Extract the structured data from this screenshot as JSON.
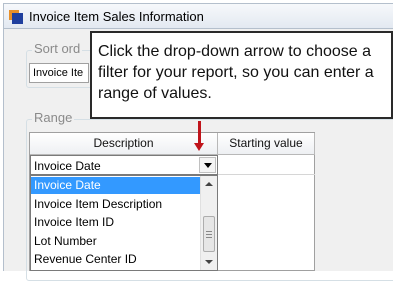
{
  "window": {
    "title": "Invoice Item Sales Information"
  },
  "sort_group": {
    "label": "Sort ord",
    "value": "Invoice Ite"
  },
  "range_group": {
    "label": "Range"
  },
  "grid": {
    "columns": [
      "Description",
      "Starting value"
    ],
    "combo_value": "Invoice Date",
    "dropdown_items": [
      "Invoice Date",
      "Invoice Item Description",
      "Invoice Item ID",
      "Lot Number",
      "Revenue Center ID"
    ],
    "selected_index": 0
  },
  "callout": {
    "text": "Click the drop-down arrow to choose a filter for your report, so you can enter a range of values."
  },
  "colors": {
    "selection": "#3399ff",
    "arrow": "#c0141b"
  }
}
